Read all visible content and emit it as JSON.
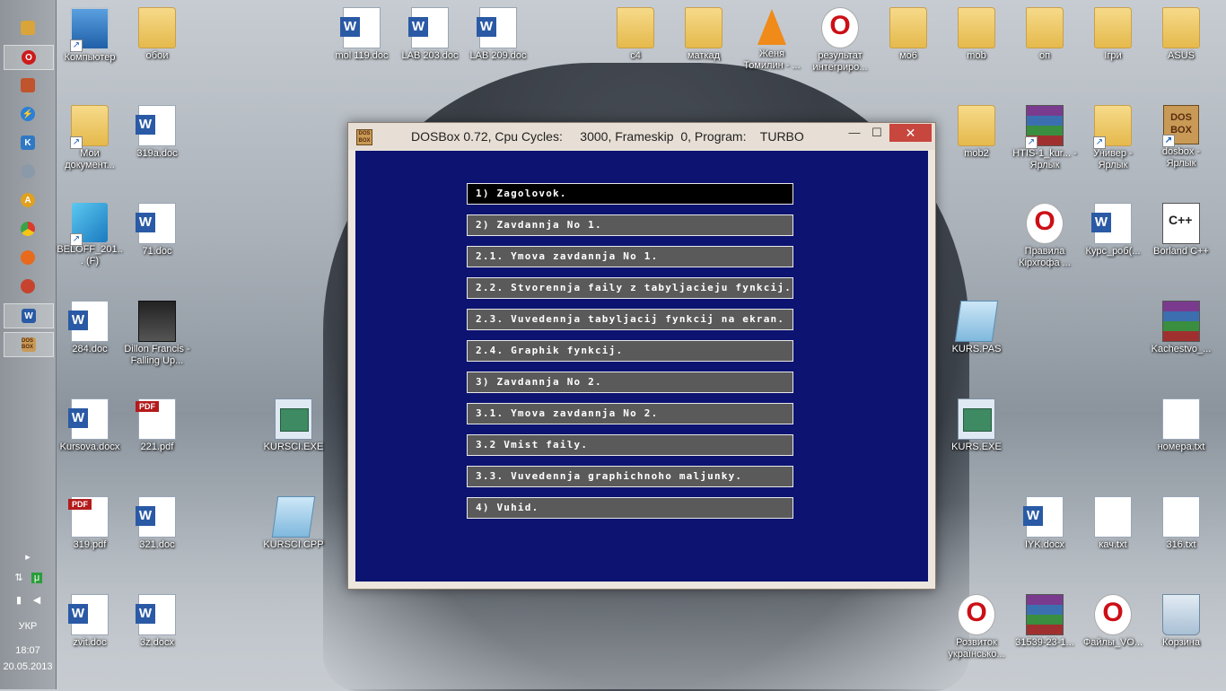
{
  "desktop": {
    "icons": [
      {
        "label": "Компьютер",
        "kind": "pc"
      },
      {
        "label": "обои",
        "kind": "folder"
      },
      {
        "label": "mol 119.doc",
        "kind": "word"
      },
      {
        "label": "LAB 203.doc",
        "kind": "word"
      },
      {
        "label": "LAB 209.doc",
        "kind": "word"
      },
      {
        "label": "c4",
        "kind": "folder"
      },
      {
        "label": "маткад",
        "kind": "folder"
      },
      {
        "label": "Женя Томилин - ...",
        "kind": "vlc"
      },
      {
        "label": "результат интегриро...",
        "kind": "opera"
      },
      {
        "label": "мо6",
        "kind": "folder"
      },
      {
        "label": "mob",
        "kind": "folder"
      },
      {
        "label": "оп",
        "kind": "folder"
      },
      {
        "label": "Ігри",
        "kind": "folder"
      },
      {
        "label": "ASUS",
        "kind": "folder"
      },
      {
        "label": "Мои документ...",
        "kind": "folder"
      },
      {
        "label": "319a.doc",
        "kind": "word"
      },
      {
        "label": "mob2",
        "kind": "folder"
      },
      {
        "label": "HTIS-1_kur... - Ярлык",
        "kind": "rar"
      },
      {
        "label": "Универ - Ярлык",
        "kind": "folder"
      },
      {
        "label": "dosbox - Ярлык",
        "kind": "dosbox"
      },
      {
        "label": "BELOFF_201... (F)",
        "kind": "install"
      },
      {
        "label": "71.doc",
        "kind": "word"
      },
      {
        "label": "Правила Кірхгофа ...",
        "kind": "opera"
      },
      {
        "label": "Курс_роб(...",
        "kind": "word"
      },
      {
        "label": "Borland C++",
        "kind": "borland"
      },
      {
        "label": "284.doc",
        "kind": "word"
      },
      {
        "label": "Dillon Francis - Falling Up...",
        "kind": "photo"
      },
      {
        "label": "KURS.PAS",
        "kind": "notepad"
      },
      {
        "label": "Kachestvo_...",
        "kind": "rar"
      },
      {
        "label": "Kursova.docx",
        "kind": "word"
      },
      {
        "label": "221.pdf",
        "kind": "pdf"
      },
      {
        "label": "KURSCI.EXE",
        "kind": "exe"
      },
      {
        "label": "KURS.EXE",
        "kind": "exe"
      },
      {
        "label": "номера.txt",
        "kind": "txt"
      },
      {
        "label": "319.pdf",
        "kind": "pdf"
      },
      {
        "label": "321.doc",
        "kind": "word"
      },
      {
        "label": "KURSCI.CPP",
        "kind": "notepad"
      },
      {
        "label": "IYK.docx",
        "kind": "word"
      },
      {
        "label": "кач.txt",
        "kind": "txt"
      },
      {
        "label": "316.txt",
        "kind": "txt"
      },
      {
        "label": "zvit.doc",
        "kind": "word"
      },
      {
        "label": "3z.docx",
        "kind": "word"
      },
      {
        "label": "Розвиток українсько...",
        "kind": "opera"
      },
      {
        "label": "31539-23-1...",
        "kind": "rar"
      },
      {
        "label": "Файлы_VO...",
        "kind": "opera"
      },
      {
        "label": "Корзина",
        "kind": "recycle"
      }
    ]
  },
  "taskbar": {
    "language": "УКР",
    "time": "18:07",
    "date": "20.05.2013",
    "dosbox_icon_text": "DOS BOX",
    "word_icon_text": "W"
  },
  "window": {
    "title": "DOSBox 0.72, Cpu Cycles:     3000, Frameskip  0, Program:    TURBO",
    "app_icon_text": "DOS BOX",
    "minimize": "—",
    "maximize": "☐",
    "close": "✕"
  },
  "menu": {
    "items": [
      {
        "label": "1) Zagolovok.",
        "selected": true
      },
      {
        "label": "2) Zavdannja No 1.",
        "selected": false
      },
      {
        "label": "2.1. Ymova zavdannja No 1.",
        "selected": false
      },
      {
        "label": "2.2. Stvorennja faily z tabyljacieju fynkcij.",
        "selected": false
      },
      {
        "label": "2.3. Vuvedennja tabyljacij fynkcij na ekran.",
        "selected": false
      },
      {
        "label": "2.4. Graphik fynkcij.",
        "selected": false
      },
      {
        "label": "3) Zavdannja No 2.",
        "selected": false
      },
      {
        "label": "3.1. Ymova zavdannja No 2.",
        "selected": false
      },
      {
        "label": "3.2 Vmist faily.",
        "selected": false
      },
      {
        "label": "3.3. Vuvedennja graphichnoho maljunky.",
        "selected": false
      },
      {
        "label": "4) Vuhid.",
        "selected": false
      }
    ]
  }
}
